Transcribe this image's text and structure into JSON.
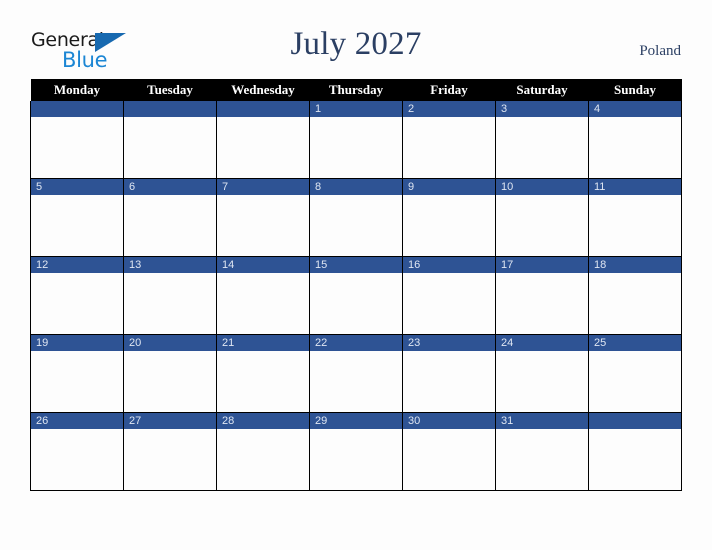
{
  "brand": {
    "name_part1": "General",
    "name_part2": "Blue",
    "triangle_icon": "triangle-icon",
    "color_dark": "#1b1b1b",
    "color_blue": "#1c86d4",
    "color_triangle": "#1769b0"
  },
  "header": {
    "title": "July 2027",
    "region": "Poland",
    "title_color": "#2b3f63"
  },
  "calendar": {
    "month": "July",
    "year": "2027",
    "country": "Poland",
    "header_bg": "#000000",
    "header_text_color": "#ffffff",
    "daybar_bg": "#2e5394",
    "daybar_text_color": "#dfe6f2",
    "cell_bg": "#fdfdfd",
    "border_color": "#000000",
    "weekday_headers": [
      "Monday",
      "Tuesday",
      "Wednesday",
      "Thursday",
      "Friday",
      "Saturday",
      "Sunday"
    ],
    "weeks": [
      [
        "",
        "",
        "",
        "1",
        "2",
        "3",
        "4"
      ],
      [
        "5",
        "6",
        "7",
        "8",
        "9",
        "10",
        "11"
      ],
      [
        "12",
        "13",
        "14",
        "15",
        "16",
        "17",
        "18"
      ],
      [
        "19",
        "20",
        "21",
        "22",
        "23",
        "24",
        "25"
      ],
      [
        "26",
        "27",
        "28",
        "29",
        "30",
        "31",
        ""
      ]
    ]
  }
}
